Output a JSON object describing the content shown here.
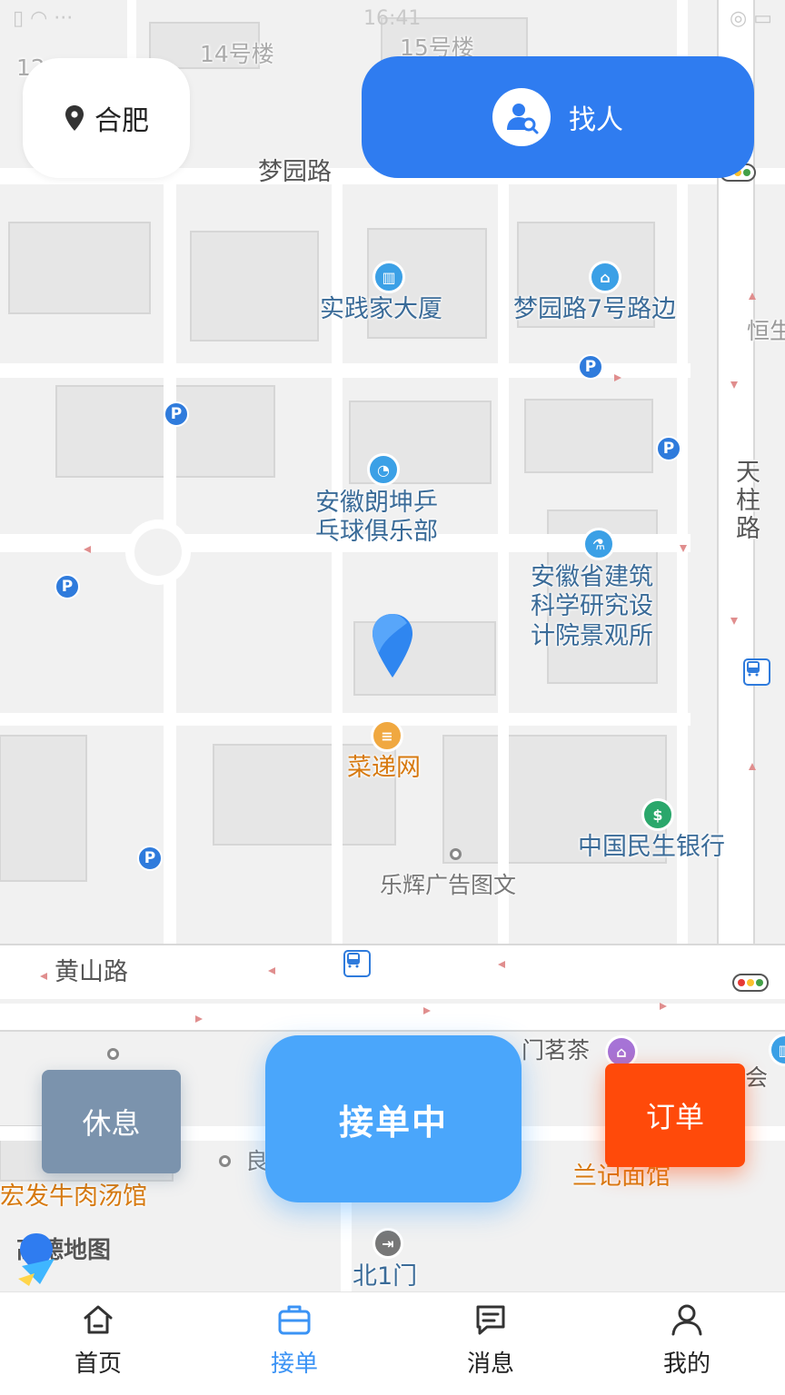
{
  "status_bar": {
    "time": "16:41",
    "left_icons": "▯ ◠ ···",
    "right_icons": "◎ ▭"
  },
  "header": {
    "city": "合肥",
    "city_icon": "location-pin-icon",
    "find_label": "找人",
    "find_icon": "person-search-icon"
  },
  "map": {
    "roads": [
      "梦园路",
      "黄山路",
      "天柱路",
      "北1门"
    ],
    "buildings": [
      "14号楼",
      "15号楼",
      "12"
    ],
    "pois": [
      "实践家大厦",
      "梦园路7号路边",
      "安徽朗坤乒乓球俱乐部",
      "安徽省建筑科学研究设计院景观所",
      "菜递网",
      "中国民生银行",
      "乐辉广告图文",
      "门茗茶",
      "兰记面馆",
      "宏发牛肉汤馆",
      "会",
      "恒生",
      "良"
    ],
    "poi_lines": {
      "pingpong": [
        "安徽朗坤乒",
        "乓球俱乐部"
      ],
      "institute": [
        "安徽省建筑",
        "科学研究设",
        "计院景观所"
      ]
    },
    "logo": "高德地图",
    "parking": "P"
  },
  "actions": {
    "rest": "休息",
    "accept": "接单中",
    "order": "订单"
  },
  "nav": {
    "items": [
      {
        "label": "首页",
        "icon": "home-icon",
        "active": false
      },
      {
        "label": "接单",
        "icon": "briefcase-icon",
        "active": true
      },
      {
        "label": "消息",
        "icon": "message-icon",
        "active": false
      },
      {
        "label": "我的",
        "icon": "profile-icon",
        "active": false
      }
    ]
  },
  "colors": {
    "accent_blue": "#2f7cf0",
    "accept_blue": "#4aa6fb",
    "rest_gray": "#7b93ad",
    "order_orange": "#ff4a0a",
    "nav_active": "#3b93f5"
  }
}
